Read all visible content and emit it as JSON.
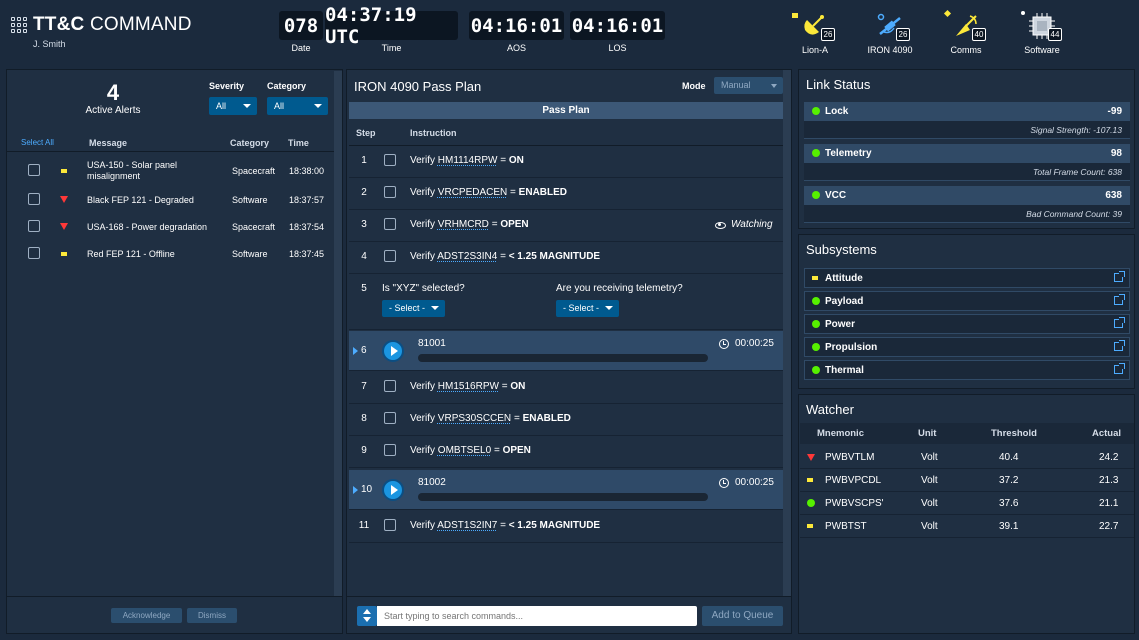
{
  "header": {
    "title_bold": "TT&C",
    "title_rest": "COMMAND",
    "user": "J. Smith",
    "clocks": [
      {
        "value": "078",
        "label": "Date"
      },
      {
        "value": "04:37:19 UTC",
        "label": "Time"
      },
      {
        "value": "04:16:01",
        "label": "AOS"
      },
      {
        "value": "04:16:01",
        "label": "LOS"
      }
    ],
    "monitors": [
      {
        "label": "Lion-A",
        "count": "26",
        "icon": "satellite-dish-icon",
        "status_color": "#fce83a"
      },
      {
        "label": "IRON 4090",
        "count": "26",
        "icon": "satellite-icon",
        "status_color": "#4dacff"
      },
      {
        "label": "Comms",
        "count": "40",
        "icon": "antenna-icon",
        "status_color": "#fce83a"
      },
      {
        "label": "Software",
        "count": "44",
        "icon": "processor-icon",
        "status_color": "#ffffff"
      }
    ]
  },
  "alerts": {
    "count": "4",
    "count_label": "Active Alerts",
    "severity_label": "Severity",
    "severity_value": "All",
    "category_label": "Category",
    "category_value": "All",
    "columns": {
      "select_all": "Select All",
      "message": "Message",
      "category": "Category",
      "time": "Time"
    },
    "rows": [
      {
        "severity": "caution",
        "message": "USA-150 - Solar panel misalignment",
        "category": "Spacecraft",
        "time": "18:38:00"
      },
      {
        "severity": "critical",
        "message": "Black FEP 121 - Degraded",
        "category": "Software",
        "time": "18:37:57"
      },
      {
        "severity": "critical",
        "message": "USA-168 - Power degradation",
        "category": "Spacecraft",
        "time": "18:37:54"
      },
      {
        "severity": "caution",
        "message": "Red FEP 121 - Offline",
        "category": "Software",
        "time": "18:37:45"
      }
    ],
    "acknowledge_label": "Acknowledge",
    "dismiss_label": "Dismiss"
  },
  "pass_plan": {
    "title": "IRON 4090 Pass Plan",
    "mode_label": "Mode",
    "mode_value": "Manual",
    "section_title": "Pass Plan",
    "col_step": "Step",
    "col_instruction": "Instruction",
    "steps": [
      {
        "num": "1",
        "verb": "Verify",
        "mnemonic": "HM1114RPW",
        "eq": "=",
        "value": "ON"
      },
      {
        "num": "2",
        "verb": "Verify",
        "mnemonic": "VRCPEDACEN",
        "eq": "=",
        "value": "ENABLED"
      },
      {
        "num": "3",
        "verb": "Verify",
        "mnemonic": "VRHMCRD",
        "eq": "=",
        "value": "OPEN",
        "status": "Watching"
      },
      {
        "num": "4",
        "verb": "Verify",
        "mnemonic": "ADST2S3IN4",
        "eq": "=",
        "value": "< 1.25 MAGNITUDE"
      },
      {
        "num": "7",
        "verb": "Verify",
        "mnemonic": "HM1516RPW",
        "eq": "=",
        "value": "ON"
      },
      {
        "num": "8",
        "verb": "Verify",
        "mnemonic": "VRPS30SCCEN",
        "eq": "=",
        "value": "ENABLED"
      },
      {
        "num": "9",
        "verb": "Verify",
        "mnemonic": "OMBTSEL0",
        "eq": "=",
        "value": "OPEN"
      },
      {
        "num": "11",
        "verb": "Verify",
        "mnemonic": "ADST1S2IN7",
        "eq": "=",
        "value": "< 1.25 MAGNITUDE"
      }
    ],
    "question_step": {
      "num": "5",
      "q1": "Is \"XYZ\" selected?",
      "q1_select": "- Select -",
      "q2": "Are you receiving telemetry?",
      "q2_select": "- Select -"
    },
    "procedures": [
      {
        "num": "6",
        "name": "81001",
        "duration": "00:00:25",
        "progress": 0
      },
      {
        "num": "10",
        "name": "81002",
        "duration": "00:00:25",
        "progress": 0
      }
    ],
    "search_placeholder": "Start typing to search commands...",
    "queue_label": "Add to Queue"
  },
  "link_status": {
    "title": "Link Status",
    "items": [
      {
        "name": "Lock",
        "value": "-99",
        "detail": "Signal Strength:  -107.13"
      },
      {
        "name": "Telemetry",
        "value": "98",
        "detail": "Total Frame Count:  638"
      },
      {
        "name": "VCC",
        "value": "638",
        "detail": "Bad Command Count:  39"
      }
    ]
  },
  "subsystems": {
    "title": "Subsystems",
    "items": [
      {
        "name": "Attitude",
        "status": "caution"
      },
      {
        "name": "Payload",
        "status": "normal"
      },
      {
        "name": "Power",
        "status": "normal"
      },
      {
        "name": "Propulsion",
        "status": "normal"
      },
      {
        "name": "Thermal",
        "status": "normal"
      }
    ]
  },
  "watcher": {
    "title": "Watcher",
    "columns": {
      "mnemonic": "Mnemonic",
      "unit": "Unit",
      "threshold": "Threshold",
      "actual": "Actual"
    },
    "rows": [
      {
        "status": "critical",
        "mnemonic": "PWBVTLM",
        "unit": "Volt",
        "threshold": "40.4",
        "actual": "24.2"
      },
      {
        "status": "caution",
        "mnemonic": "PWBVPCDL",
        "unit": "Volt",
        "threshold": "37.2",
        "actual": "21.3"
      },
      {
        "status": "normal",
        "mnemonic": "PWBVSCPS'",
        "unit": "Volt",
        "threshold": "37.6",
        "actual": "21.1"
      },
      {
        "status": "caution",
        "mnemonic": "PWBTST",
        "unit": "Volt",
        "threshold": "39.1",
        "actual": "22.7"
      }
    ]
  },
  "colors": {
    "critical": "#ff3838",
    "caution": "#fce83a",
    "normal": "#56f000",
    "accent": "#4dacff",
    "background": "#1b2a3d"
  }
}
